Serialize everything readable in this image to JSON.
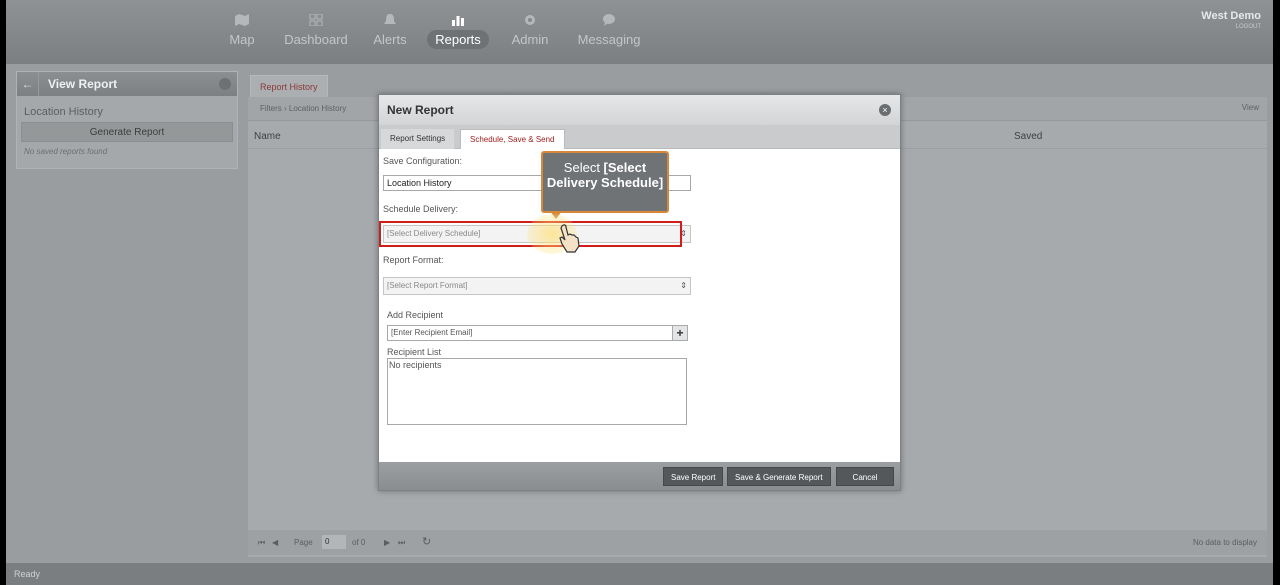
{
  "nav": {
    "items": [
      {
        "label": "Map",
        "icon": "map-icon"
      },
      {
        "label": "Dashboard",
        "icon": "dashboard-icon"
      },
      {
        "label": "Alerts",
        "icon": "bell-icon"
      },
      {
        "label": "Reports",
        "icon": "bar-chart-icon",
        "active": true
      },
      {
        "label": "Admin",
        "icon": "gear-icon"
      },
      {
        "label": "Messaging",
        "icon": "chat-icon"
      }
    ],
    "user_name": "West Demo",
    "logout": "LOGOUT"
  },
  "left_panel": {
    "title": "View Report",
    "subtitle": "Location History",
    "generate_button": "Generate Report",
    "empty_text": "No saved reports found"
  },
  "main": {
    "tab": "Report History",
    "filters_text": "Filters  ›  Location History",
    "view_label": "View",
    "col_name": "Name",
    "col_saved": "Saved",
    "pager_page": "Page",
    "pager_value": "0",
    "pager_of": "of 0",
    "no_data": "No data to display"
  },
  "status": "Ready",
  "modal": {
    "title": "New Report",
    "tab1": "Report Settings",
    "tab2": "Schedule, Save & Send",
    "save_config_label": "Save Configuration:",
    "save_config_value": "Location History",
    "schedule_label": "Schedule Delivery:",
    "schedule_value": "[Select Delivery Schedule]",
    "format_label": "Report Format:",
    "format_value": "[Select Report Format]",
    "add_recipient_label": "Add Recipient",
    "recipient_placeholder": "[Enter Recipient Email]",
    "add_symbol": "+",
    "recipient_list_label": "Recipient List",
    "recipient_list_value": "No recipients",
    "btn_save": "Save Report",
    "btn_save_generate": "Save & Generate Report",
    "btn_cancel": "Cancel"
  },
  "callout": {
    "prefix": "Select ",
    "bold": "[Select Delivery Schedule]"
  },
  "colors": {
    "highlight": "#d11c1c",
    "callout_border": "#d9883a",
    "active_tab_text": "#a02020"
  }
}
